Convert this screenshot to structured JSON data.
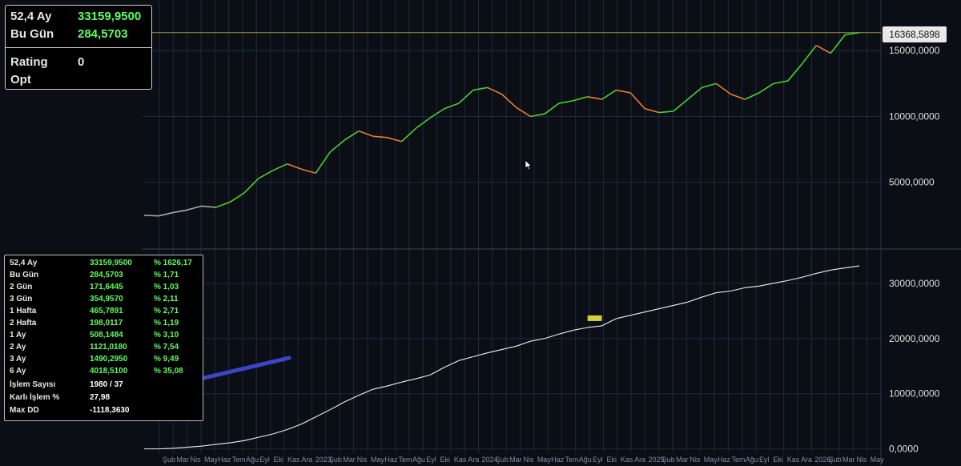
{
  "colors": {
    "background": "#0b0e15",
    "grid": "#1c2a3f",
    "price_up": "#46d22c",
    "price_down": "#f07a2a",
    "equity": "#f0f0f0",
    "highlight": "#d7cf3a",
    "price_line": "#9a9a3a",
    "arrow": "#3a45c8"
  },
  "top_panel": {
    "r1_label": "52,4 Ay",
    "r1_value": "33159,9500",
    "r2_label": "Bu Gün",
    "r2_value": "284,5703",
    "r3_label": "Rating",
    "r3_value": "0",
    "r4_label": "Opt"
  },
  "price_tag": "16368,5898",
  "stats": [
    {
      "label": "52,4 Ay",
      "value": "33159,9500",
      "pct": "% 1626,17"
    },
    {
      "label": "Bu Gün",
      "value": "284,5703",
      "pct": "% 1,71"
    },
    {
      "label": "2 Gün",
      "value": "171,6445",
      "pct": "% 1,03"
    },
    {
      "label": "3 Gün",
      "value": "354,9570",
      "pct": "% 2,11"
    },
    {
      "label": "1 Hafta",
      "value": "465,7891",
      "pct": "% 2,71"
    },
    {
      "label": "2 Hafta",
      "value": "198,0117",
      "pct": "% 1,19"
    },
    {
      "label": "1 Ay",
      "value": "508,1484",
      "pct": "% 3,10"
    },
    {
      "label": "2 Ay",
      "value": "1121,0180",
      "pct": "% 7,54"
    },
    {
      "label": "3 Ay",
      "value": "1490,2950",
      "pct": "% 9,49"
    },
    {
      "label": "6 Ay",
      "value": "4018,5100",
      "pct": "% 35,08"
    }
  ],
  "stats_extra": [
    {
      "label": "İşlem Sayısı",
      "value": "1980 / 37"
    },
    {
      "label": "Karlı İşlem %",
      "value": "27,98"
    },
    {
      "label": "Max DD",
      "value": "-1118,3630"
    }
  ],
  "chart_data": [
    {
      "type": "line",
      "axis_ticks": [
        "15000,0000",
        "10000,0000",
        "5000,0000"
      ],
      "tick_values": [
        15000,
        10000,
        5000
      ],
      "ylim": [
        0,
        18600
      ],
      "last_price": 16368.5898,
      "x": [
        0,
        0.02,
        0.04,
        0.06,
        0.08,
        0.1,
        0.12,
        0.14,
        0.16,
        0.18,
        0.2,
        0.22,
        0.24,
        0.26,
        0.28,
        0.3,
        0.32,
        0.34,
        0.36,
        0.38,
        0.4,
        0.42,
        0.44,
        0.46,
        0.48,
        0.5,
        0.52,
        0.54,
        0.56,
        0.58,
        0.6,
        0.62,
        0.64,
        0.66,
        0.68,
        0.7,
        0.72,
        0.74,
        0.76,
        0.78,
        0.8,
        0.82,
        0.84,
        0.86,
        0.88,
        0.9,
        0.92,
        0.94,
        0.96,
        0.98,
        1.0
      ],
      "values": [
        2500,
        2450,
        2700,
        2900,
        3200,
        3100,
        3500,
        4200,
        5300,
        5900,
        6400,
        6000,
        5700,
        7300,
        8200,
        8900,
        8500,
        8400,
        8100,
        9100,
        9900,
        10600,
        11000,
        12000,
        12200,
        11700,
        10700,
        10000,
        10200,
        11000,
        11200,
        11500,
        11300,
        12000,
        11800,
        10600,
        10300,
        10400,
        11300,
        12200,
        12500,
        11700,
        11300,
        11800,
        12500,
        12700,
        14000,
        15400,
        14800,
        16200,
        16368
      ]
    },
    {
      "type": "line",
      "axis_ticks": [
        "30000,0000",
        "20000,0000",
        "10000,0000",
        "0,0000"
      ],
      "tick_values": [
        30000,
        20000,
        10000,
        0
      ],
      "ylim": [
        -200,
        35200
      ],
      "x": [
        0,
        0.02,
        0.04,
        0.06,
        0.08,
        0.1,
        0.12,
        0.14,
        0.16,
        0.18,
        0.2,
        0.22,
        0.24,
        0.26,
        0.28,
        0.3,
        0.32,
        0.34,
        0.36,
        0.38,
        0.4,
        0.42,
        0.44,
        0.46,
        0.48,
        0.5,
        0.52,
        0.54,
        0.56,
        0.58,
        0.6,
        0.62,
        0.64,
        0.66,
        0.68,
        0.7,
        0.72,
        0.74,
        0.76,
        0.78,
        0.8,
        0.82,
        0.84,
        0.86,
        0.88,
        0.9,
        0.92,
        0.94,
        0.96,
        0.98,
        1.0
      ],
      "values": [
        0,
        0,
        100,
        300,
        500,
        800,
        1100,
        1500,
        2100,
        2700,
        3500,
        4500,
        5800,
        7100,
        8500,
        9700,
        10800,
        11400,
        12100,
        12700,
        13400,
        14800,
        16000,
        16700,
        17400,
        18000,
        18600,
        19500,
        20000,
        20800,
        21500,
        22000,
        22300,
        23600,
        24200,
        24800,
        25400,
        26000,
        26600,
        27500,
        28300,
        28600,
        29200,
        29500,
        30000,
        30500,
        31100,
        31800,
        32400,
        32800,
        33160
      ],
      "highlight_range": [
        0.62,
        0.64
      ]
    }
  ],
  "x_axis_labels": [
    "Şub",
    "Mar",
    "Nis",
    "May",
    "Haz",
    "Tem",
    "Ağu",
    "Eyl",
    "Eki",
    "Kas",
    "Ara",
    "2023",
    "Şub",
    "Mar",
    "Nis",
    "May",
    "Haz",
    "Tem",
    "Ağu",
    "Eyl",
    "Eki",
    "Kas",
    "Ara",
    "2024",
    "Şub",
    "Mar",
    "Nis",
    "May",
    "Haz",
    "Tem",
    "Ağu",
    "Eyl",
    "Eki",
    "Kas",
    "Ara",
    "2025",
    "Şub",
    "Mar",
    "Nis",
    "May",
    "Haz",
    "Tem",
    "Ağu",
    "Eyl",
    "Eki",
    "Kas",
    "Ara",
    "2026",
    "Şub",
    "Mar",
    "Nis",
    "May"
  ]
}
